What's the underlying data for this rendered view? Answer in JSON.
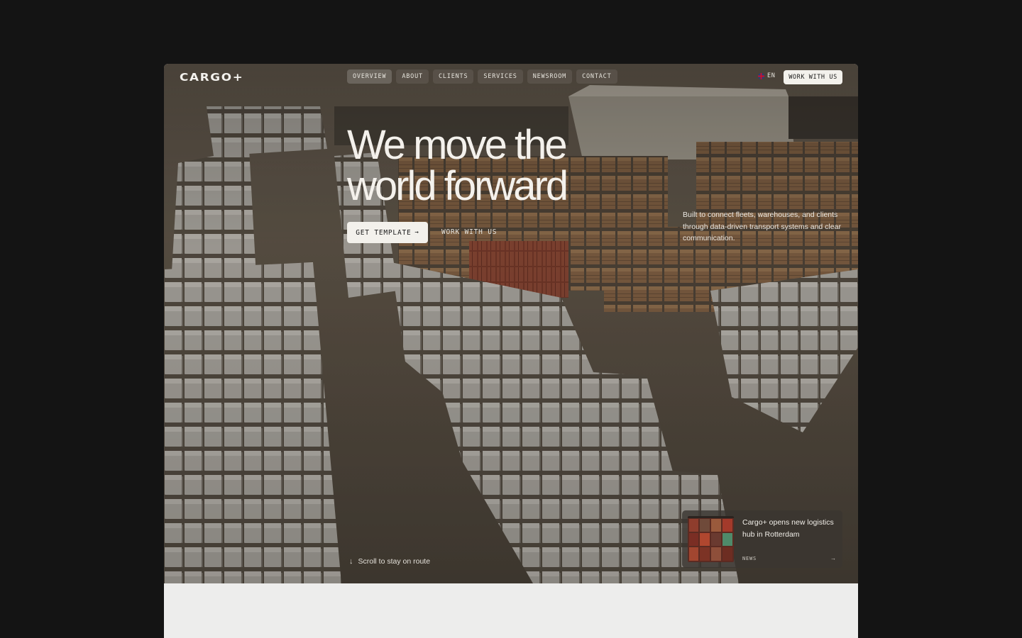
{
  "brand": {
    "logo": "CARGO+"
  },
  "nav": {
    "items": [
      "OVERVIEW",
      "ABOUT",
      "CLIENTS",
      "SERVICES",
      "NEWSROOM",
      "CONTACT"
    ],
    "active_index": 0
  },
  "header": {
    "lang_label": "EN",
    "cta_label": "WORK WITH US"
  },
  "hero": {
    "headline_line1": "We move the",
    "headline_line2": "world forward",
    "description": "Built to connect fleets, warehouses, and clients through data-driven transport systems and clear communication.",
    "primary_cta": "GET TEMPLATE",
    "secondary_cta": "WORK WITH US",
    "scroll_hint": "Scroll to stay on route"
  },
  "news": {
    "title": "Cargo+ opens new logistics hub in Rotterdam",
    "tag": "NEWS"
  },
  "icons": {
    "primary_cta_arrow": "arrow-right-icon",
    "scroll_arrow": "arrow-down-icon",
    "news_arrow": "arrow-right-icon",
    "lang_flag": "uk-flag-icon"
  },
  "colors": {
    "page_background": "#141414",
    "button_background": "#f3f1ec",
    "below_fold_background": "#ededec"
  }
}
